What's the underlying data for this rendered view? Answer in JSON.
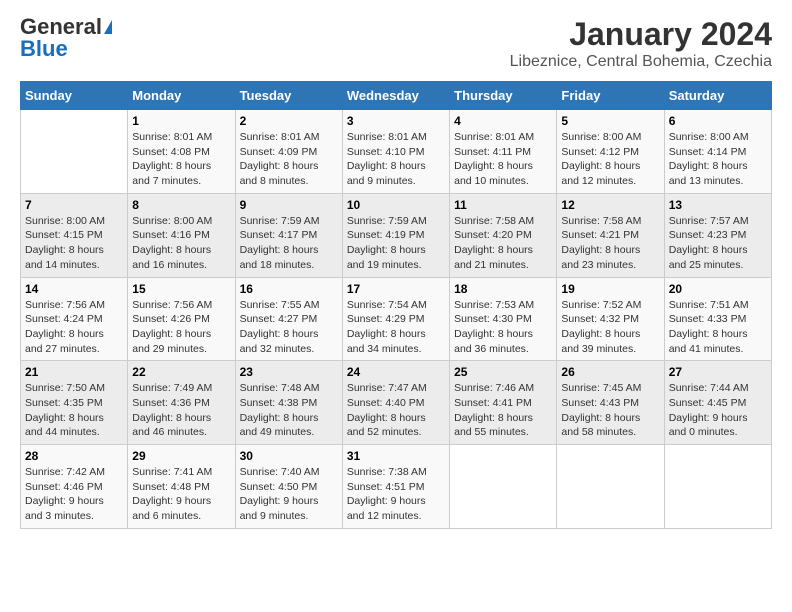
{
  "logo": {
    "general": "General",
    "blue": "Blue"
  },
  "title": "January 2024",
  "subtitle": "Libeznice, Central Bohemia, Czechia",
  "days_of_week": [
    "Sunday",
    "Monday",
    "Tuesday",
    "Wednesday",
    "Thursday",
    "Friday",
    "Saturday"
  ],
  "weeks": [
    [
      {
        "day": "",
        "info": ""
      },
      {
        "day": "1",
        "info": "Sunrise: 8:01 AM\nSunset: 4:08 PM\nDaylight: 8 hours\nand 7 minutes."
      },
      {
        "day": "2",
        "info": "Sunrise: 8:01 AM\nSunset: 4:09 PM\nDaylight: 8 hours\nand 8 minutes."
      },
      {
        "day": "3",
        "info": "Sunrise: 8:01 AM\nSunset: 4:10 PM\nDaylight: 8 hours\nand 9 minutes."
      },
      {
        "day": "4",
        "info": "Sunrise: 8:01 AM\nSunset: 4:11 PM\nDaylight: 8 hours\nand 10 minutes."
      },
      {
        "day": "5",
        "info": "Sunrise: 8:00 AM\nSunset: 4:12 PM\nDaylight: 8 hours\nand 12 minutes."
      },
      {
        "day": "6",
        "info": "Sunrise: 8:00 AM\nSunset: 4:14 PM\nDaylight: 8 hours\nand 13 minutes."
      }
    ],
    [
      {
        "day": "7",
        "info": "Sunrise: 8:00 AM\nSunset: 4:15 PM\nDaylight: 8 hours\nand 14 minutes."
      },
      {
        "day": "8",
        "info": "Sunrise: 8:00 AM\nSunset: 4:16 PM\nDaylight: 8 hours\nand 16 minutes."
      },
      {
        "day": "9",
        "info": "Sunrise: 7:59 AM\nSunset: 4:17 PM\nDaylight: 8 hours\nand 18 minutes."
      },
      {
        "day": "10",
        "info": "Sunrise: 7:59 AM\nSunset: 4:19 PM\nDaylight: 8 hours\nand 19 minutes."
      },
      {
        "day": "11",
        "info": "Sunrise: 7:58 AM\nSunset: 4:20 PM\nDaylight: 8 hours\nand 21 minutes."
      },
      {
        "day": "12",
        "info": "Sunrise: 7:58 AM\nSunset: 4:21 PM\nDaylight: 8 hours\nand 23 minutes."
      },
      {
        "day": "13",
        "info": "Sunrise: 7:57 AM\nSunset: 4:23 PM\nDaylight: 8 hours\nand 25 minutes."
      }
    ],
    [
      {
        "day": "14",
        "info": "Sunrise: 7:56 AM\nSunset: 4:24 PM\nDaylight: 8 hours\nand 27 minutes."
      },
      {
        "day": "15",
        "info": "Sunrise: 7:56 AM\nSunset: 4:26 PM\nDaylight: 8 hours\nand 29 minutes."
      },
      {
        "day": "16",
        "info": "Sunrise: 7:55 AM\nSunset: 4:27 PM\nDaylight: 8 hours\nand 32 minutes."
      },
      {
        "day": "17",
        "info": "Sunrise: 7:54 AM\nSunset: 4:29 PM\nDaylight: 8 hours\nand 34 minutes."
      },
      {
        "day": "18",
        "info": "Sunrise: 7:53 AM\nSunset: 4:30 PM\nDaylight: 8 hours\nand 36 minutes."
      },
      {
        "day": "19",
        "info": "Sunrise: 7:52 AM\nSunset: 4:32 PM\nDaylight: 8 hours\nand 39 minutes."
      },
      {
        "day": "20",
        "info": "Sunrise: 7:51 AM\nSunset: 4:33 PM\nDaylight: 8 hours\nand 41 minutes."
      }
    ],
    [
      {
        "day": "21",
        "info": "Sunrise: 7:50 AM\nSunset: 4:35 PM\nDaylight: 8 hours\nand 44 minutes."
      },
      {
        "day": "22",
        "info": "Sunrise: 7:49 AM\nSunset: 4:36 PM\nDaylight: 8 hours\nand 46 minutes."
      },
      {
        "day": "23",
        "info": "Sunrise: 7:48 AM\nSunset: 4:38 PM\nDaylight: 8 hours\nand 49 minutes."
      },
      {
        "day": "24",
        "info": "Sunrise: 7:47 AM\nSunset: 4:40 PM\nDaylight: 8 hours\nand 52 minutes."
      },
      {
        "day": "25",
        "info": "Sunrise: 7:46 AM\nSunset: 4:41 PM\nDaylight: 8 hours\nand 55 minutes."
      },
      {
        "day": "26",
        "info": "Sunrise: 7:45 AM\nSunset: 4:43 PM\nDaylight: 8 hours\nand 58 minutes."
      },
      {
        "day": "27",
        "info": "Sunrise: 7:44 AM\nSunset: 4:45 PM\nDaylight: 9 hours\nand 0 minutes."
      }
    ],
    [
      {
        "day": "28",
        "info": "Sunrise: 7:42 AM\nSunset: 4:46 PM\nDaylight: 9 hours\nand 3 minutes."
      },
      {
        "day": "29",
        "info": "Sunrise: 7:41 AM\nSunset: 4:48 PM\nDaylight: 9 hours\nand 6 minutes."
      },
      {
        "day": "30",
        "info": "Sunrise: 7:40 AM\nSunset: 4:50 PM\nDaylight: 9 hours\nand 9 minutes."
      },
      {
        "day": "31",
        "info": "Sunrise: 7:38 AM\nSunset: 4:51 PM\nDaylight: 9 hours\nand 12 minutes."
      },
      {
        "day": "",
        "info": ""
      },
      {
        "day": "",
        "info": ""
      },
      {
        "day": "",
        "info": ""
      }
    ]
  ]
}
